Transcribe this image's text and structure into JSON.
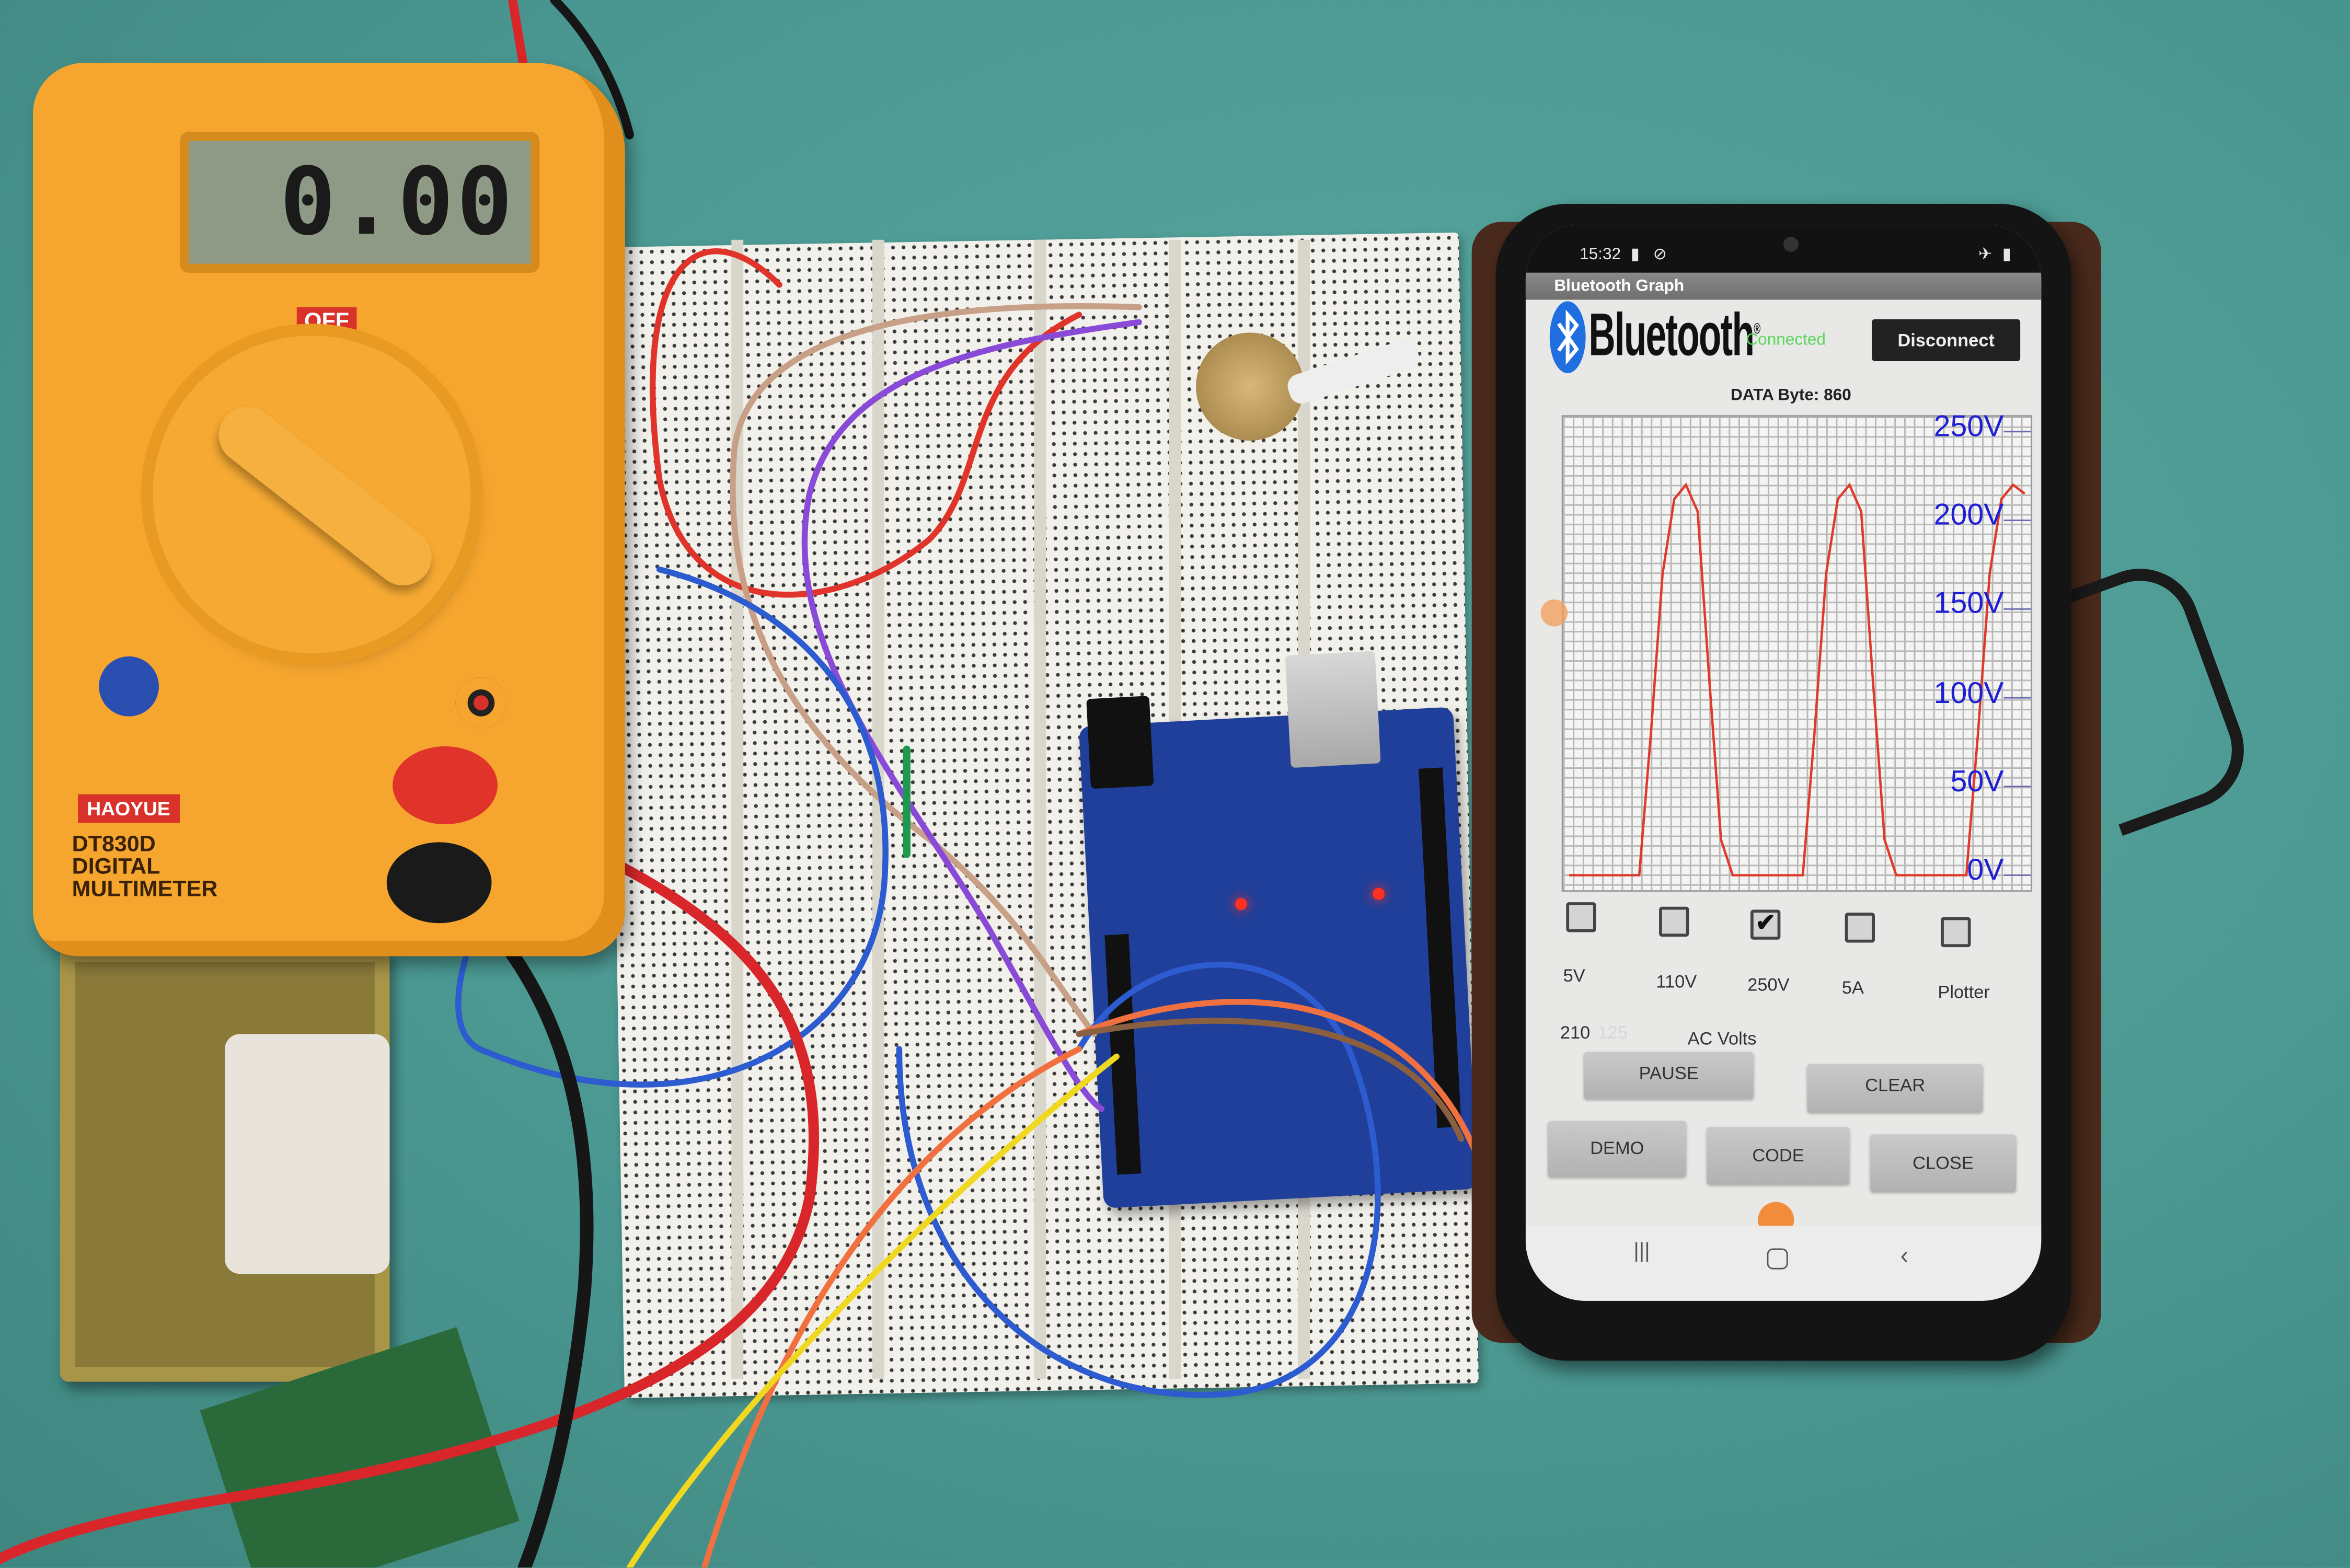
{
  "multimeter": {
    "display": "0.00",
    "off_label": "OFF",
    "brand": "HAOYUE",
    "model": "DT830D",
    "line1": "DIGITAL",
    "line2": "MULTIMETER",
    "body_color": "#f6a62e"
  },
  "phone": {
    "status_bar": {
      "time": "15:32",
      "icons": [
        "video-camera-icon",
        "shield-icon",
        "airplane-icon",
        "battery-icon"
      ]
    },
    "app_title": "Bluetooth Graph",
    "header": {
      "logo_text": "Bluetooth",
      "registered_mark": "®",
      "connection_status": "Connected",
      "connection_color": "#5cd65c",
      "disconnect_label": "Disconnect"
    },
    "data_label": "DATA Byte: 860",
    "checkboxes": [
      {
        "label": "5V",
        "checked": false
      },
      {
        "label": "110V",
        "checked": false
      },
      {
        "label": "250V",
        "checked": true
      },
      {
        "label": "5A",
        "checked": false
      },
      {
        "label": "Plotter",
        "checked": false
      }
    ],
    "reading": "210",
    "reading_faint": "125",
    "reading_unit": "AC Volts",
    "buttons": {
      "pause": "PAUSE",
      "clear": "CLEAR",
      "demo": "DEMO",
      "code": "CODE",
      "close": "CLOSE"
    },
    "nav": [
      "recent-apps-icon",
      "home-icon",
      "back-icon"
    ]
  },
  "chart_data": {
    "type": "line",
    "title": "",
    "xlabel": "",
    "ylabel": "",
    "ylim": [
      0,
      250
    ],
    "y_ticks": [
      "0V",
      "50V",
      "100V",
      "150V",
      "200V",
      "250V"
    ],
    "grid": true,
    "line_color": "#e03a2a",
    "tick_color": "#1f1fd6",
    "x": [
      0,
      1,
      2,
      3,
      4,
      5,
      6,
      7,
      8,
      9,
      10,
      11,
      12,
      13,
      14,
      15,
      16,
      17,
      18,
      19,
      20,
      21,
      22,
      23,
      24,
      25,
      26,
      27,
      28,
      29,
      30,
      31,
      32,
      33,
      34,
      35,
      36,
      37,
      38,
      39
    ],
    "values": [
      0,
      0,
      0,
      0,
      0,
      0,
      0,
      80,
      170,
      212,
      220,
      205,
      110,
      20,
      0,
      0,
      0,
      0,
      0,
      0,
      0,
      80,
      170,
      212,
      220,
      205,
      110,
      20,
      0,
      0,
      0,
      0,
      0,
      0,
      0,
      80,
      170,
      212,
      220,
      215
    ]
  }
}
